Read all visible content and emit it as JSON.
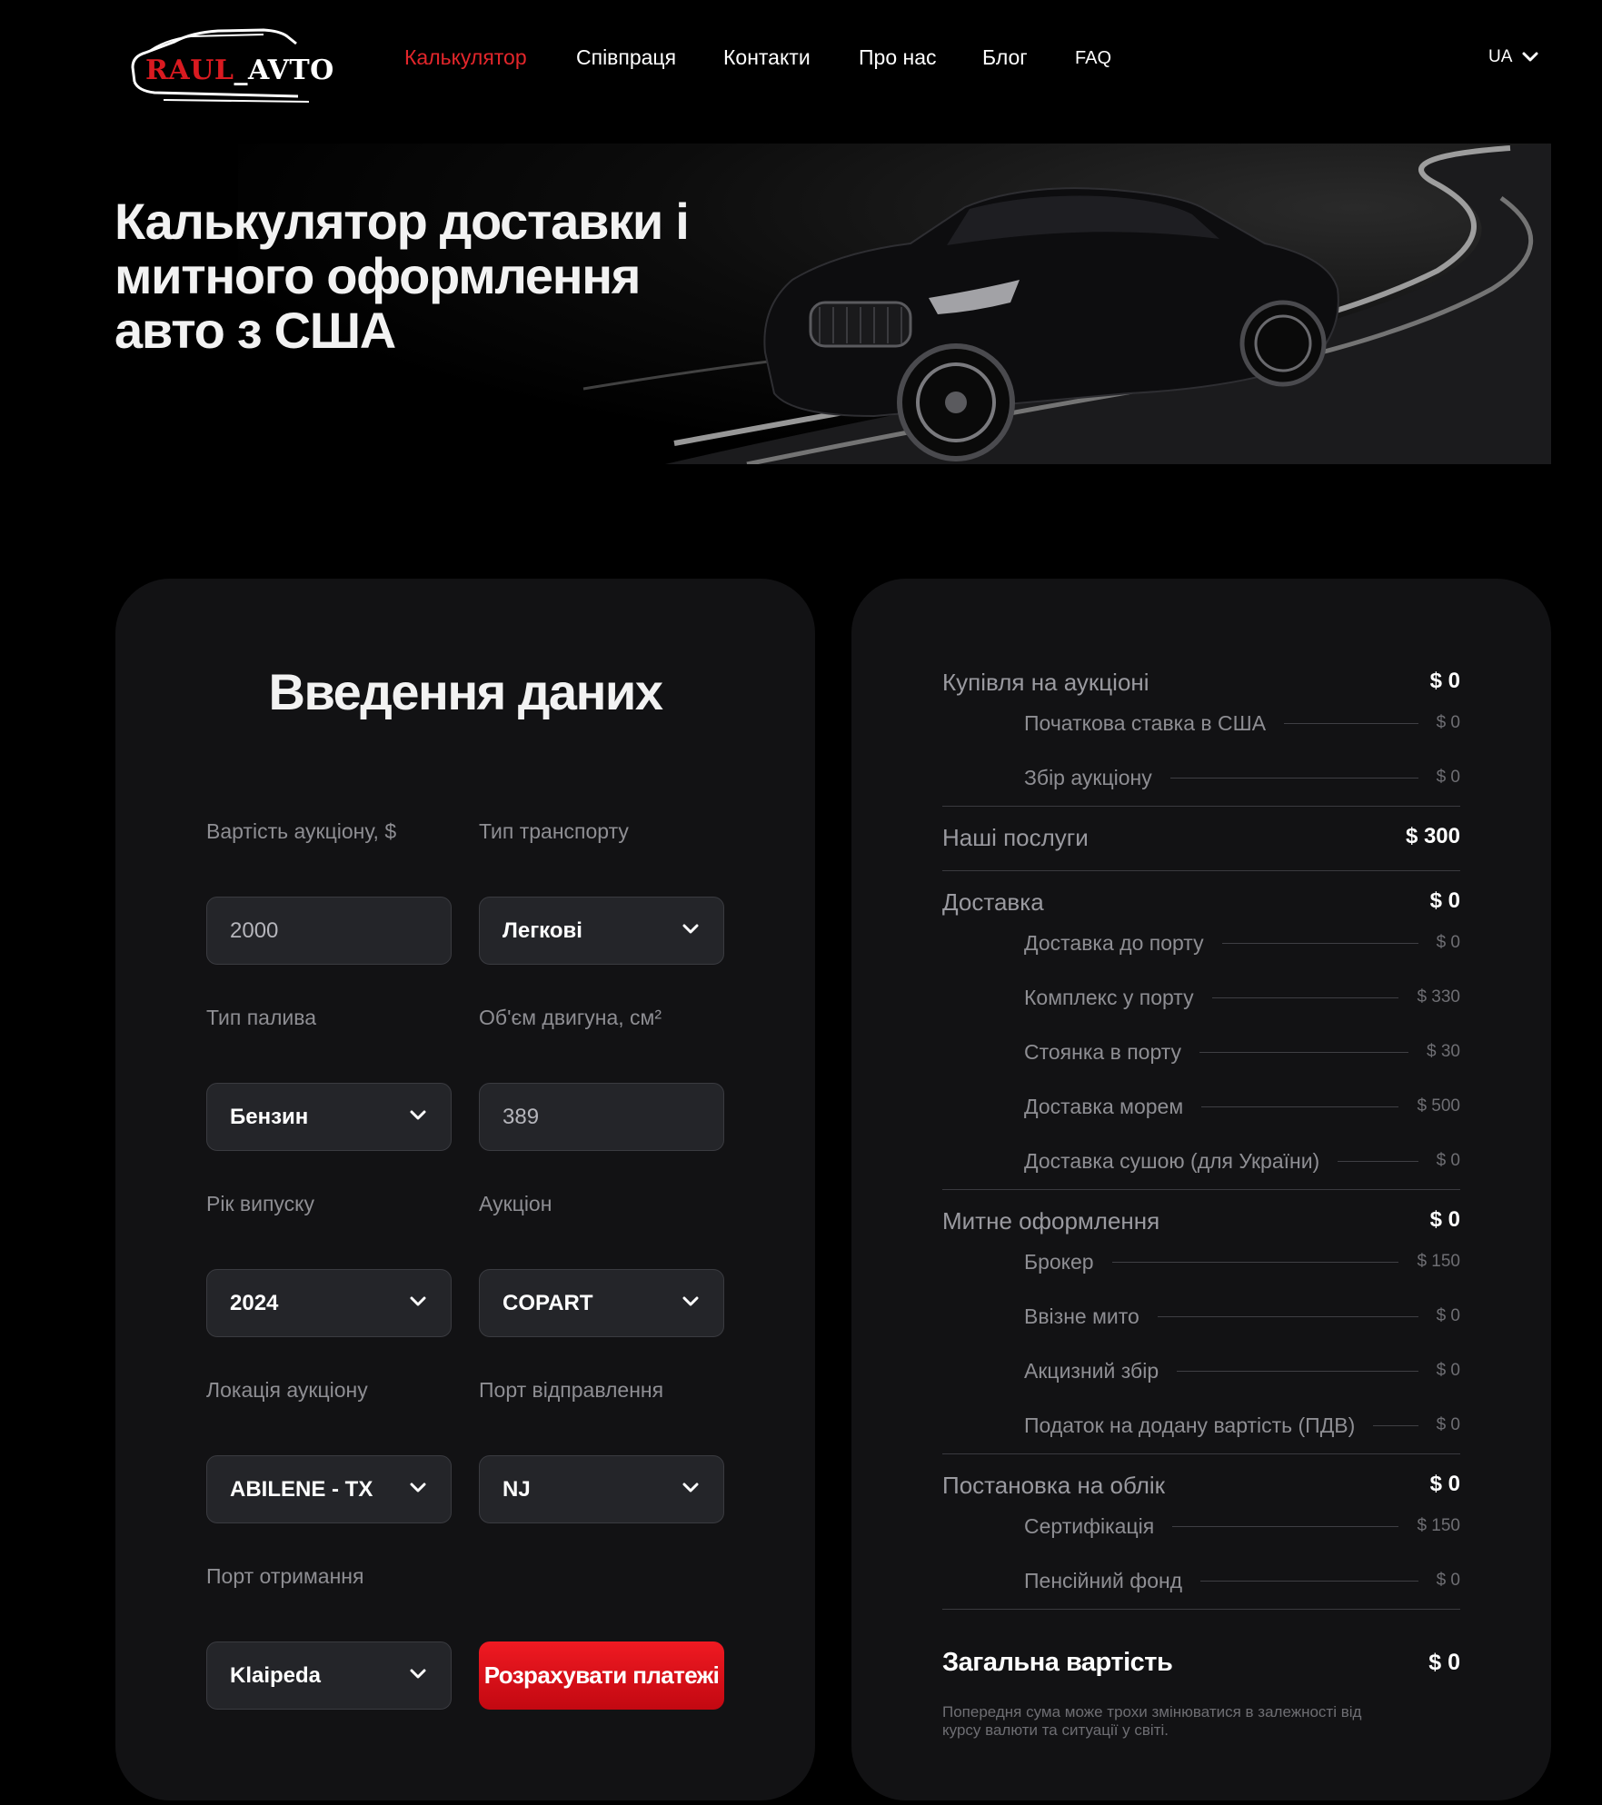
{
  "header": {
    "logo_text_red": "RAUL",
    "logo_text_white": "_AVTO",
    "nav": [
      {
        "label": "Калькулятор",
        "active": true
      },
      {
        "label": "Співпраця",
        "active": false
      },
      {
        "label": "Контакти",
        "active": false
      },
      {
        "label": "Про нас",
        "active": false
      },
      {
        "label": "Блог",
        "active": false
      },
      {
        "label": "FAQ",
        "active": false
      }
    ],
    "language": "UA"
  },
  "hero": {
    "title": "Калькулятор доставки і митного оформлення авто з США"
  },
  "form": {
    "title": "Введення даних",
    "auction_price": {
      "label": "Вартість аукціону, $",
      "value": "2000"
    },
    "vehicle_type": {
      "label": "Тип транспорту",
      "value": "Легкові"
    },
    "fuel_type": {
      "label": "Тип палива",
      "value": "Бензин"
    },
    "engine_volume": {
      "label": "Об'єм двигуна, см²",
      "value": "389"
    },
    "year": {
      "label": "Рік випуску",
      "value": "2024"
    },
    "auction": {
      "label": "Аукціон",
      "value": "COPART"
    },
    "auction_location": {
      "label": "Локація аукціону",
      "value": "ABILENE - TX"
    },
    "departure_port": {
      "label": "Порт відправлення",
      "value": "NJ"
    },
    "arrival_port": {
      "label": "Порт отримання",
      "value": "Klaipeda"
    },
    "submit_label": "Розрахувати платежі"
  },
  "summary": {
    "auction_purchase": {
      "label": "Купівля на аукціоні",
      "amount": "$ 0"
    },
    "initial_bid": {
      "label": "Початкова ставка в США",
      "amount": "$ 0"
    },
    "auction_fee": {
      "label": "Збір аукціону",
      "amount": "$ 0"
    },
    "our_services": {
      "label": "Наші послуги",
      "amount": "$ 300"
    },
    "delivery": {
      "label": "Доставка",
      "amount": "$ 0"
    },
    "delivery_to_port": {
      "label": "Доставка до порту",
      "amount": "$ 0"
    },
    "port_complex": {
      "label": "Комплекс у порту",
      "amount": "$ 330"
    },
    "port_parking": {
      "label": "Стоянка в порту",
      "amount": "$ 30"
    },
    "sea_delivery": {
      "label": "Доставка морем",
      "amount": "$ 500"
    },
    "land_delivery": {
      "label": "Доставка сушою (для України)",
      "amount": "$ 0"
    },
    "customs": {
      "label": "Митне оформлення",
      "amount": "$ 0"
    },
    "broker": {
      "label": "Брокер",
      "amount": "$ 150"
    },
    "import_duty": {
      "label": "Ввізне мито",
      "amount": "$ 0"
    },
    "excise": {
      "label": "Акцизний збір",
      "amount": "$ 0"
    },
    "vat": {
      "label": "Податок на додану вартість (ПДВ)",
      "amount": "$ 0"
    },
    "registration": {
      "label": "Постановка на облік",
      "amount": "$ 0"
    },
    "certification": {
      "label": "Сертифікація",
      "amount": "$ 150"
    },
    "pension_fund": {
      "label": "Пенсійний фонд",
      "amount": "$ 0"
    },
    "total": {
      "label": "Загальна вартість",
      "amount": "$ 0"
    },
    "note": "Попередня сума може трохи змінюватися в залежності від курсу валюти та ситуації у світі."
  },
  "colors": {
    "accent": "#e3262b",
    "background": "#000000",
    "panel": "#121214",
    "field": "#242529"
  }
}
